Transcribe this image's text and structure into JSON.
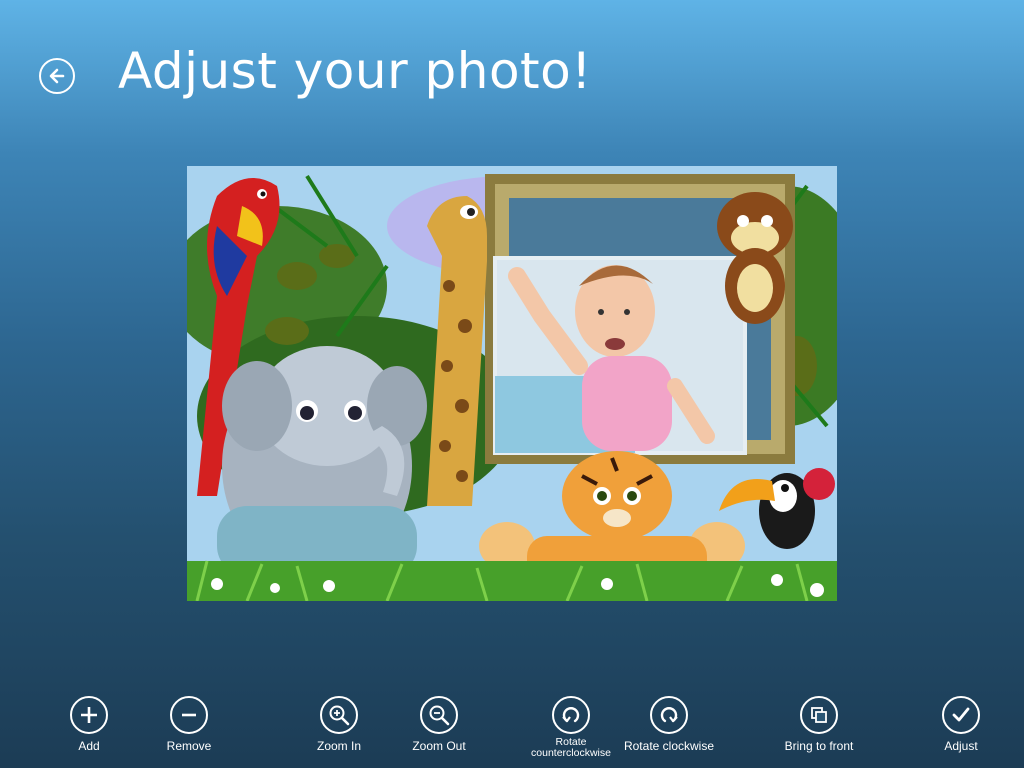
{
  "header": {
    "title": "Adjust your photo!",
    "back_icon": "back-arrow-icon"
  },
  "photo": {
    "description_icon": "photo-frame-composite"
  },
  "appbar": {
    "commands": [
      {
        "label": "Add",
        "icon": "add-icon"
      },
      {
        "label": "Remove",
        "icon": "remove-icon"
      },
      {
        "label": "Zoom In",
        "icon": "zoom-in-icon"
      },
      {
        "label": "Zoom Out",
        "icon": "zoom-out-icon"
      },
      {
        "label_line1": "Rotate",
        "label_line2": "counterclockwise",
        "icon": "rotate-ccw-icon"
      },
      {
        "label": "Rotate clockwise",
        "icon": "rotate-cw-icon"
      },
      {
        "label": "Bring to front",
        "icon": "bring-to-front-icon"
      },
      {
        "label": "Adjust",
        "icon": "checkmark-icon"
      }
    ]
  },
  "colors": {
    "background_top": "#5fb3e6",
    "background_bottom": "#1c3c55",
    "text": "#ffffff"
  }
}
